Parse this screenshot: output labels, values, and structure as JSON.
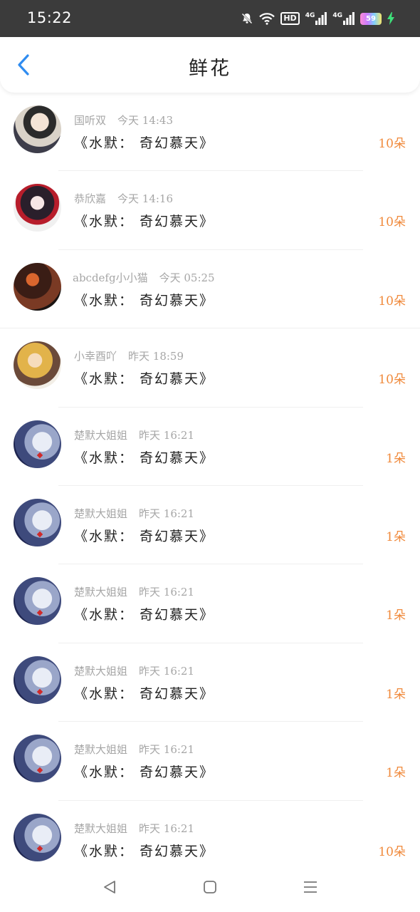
{
  "status_bar": {
    "time": "15:22",
    "hd_label": "HD",
    "signal1_label": "4G",
    "signal2_label": "4G",
    "battery_level": "59",
    "icons": [
      "mute-bell-icon",
      "wifi-icon",
      "hd-icon",
      "signal-4g-icon",
      "signal-4g-icon",
      "battery-icon",
      "charging-icon"
    ]
  },
  "header": {
    "title": "鲜花",
    "back_icon": "chevron-left-icon",
    "accent_color": "#2f8cf0"
  },
  "list": {
    "count_color": "#f08a3c",
    "items": [
      {
        "user": "国听双",
        "time": "今天 14:43",
        "title": "《水默：  奇幻慕天》",
        "count": "10朵"
      },
      {
        "user": "恭欣嘉",
        "time": "今天 14:16",
        "title": "《水默：  奇幻慕天》",
        "count": "10朵"
      },
      {
        "user": "abcdefg小小猫",
        "time": "今天 05:25",
        "title": "《水默：  奇幻慕天》",
        "count": "10朵"
      },
      {
        "user": "小幸酉吖",
        "time": "昨天 18:59",
        "title": "《水默：  奇幻慕天》",
        "count": "10朵"
      },
      {
        "user": "楚默大姐姐",
        "time": "昨天 16:21",
        "title": "《水默：  奇幻慕天》",
        "count": "1朵"
      },
      {
        "user": "楚默大姐姐",
        "time": "昨天 16:21",
        "title": "《水默：  奇幻慕天》",
        "count": "1朵"
      },
      {
        "user": "楚默大姐姐",
        "time": "昨天 16:21",
        "title": "《水默：  奇幻慕天》",
        "count": "1朵"
      },
      {
        "user": "楚默大姐姐",
        "time": "昨天 16:21",
        "title": "《水默：  奇幻慕天》",
        "count": "1朵"
      },
      {
        "user": "楚默大姐姐",
        "time": "昨天 16:21",
        "title": "《水默：  奇幻慕天》",
        "count": "1朵"
      },
      {
        "user": "楚默大姐姐",
        "time": "昨天 16:21",
        "title": "《水默：  奇幻慕天》",
        "count": "10朵"
      }
    ]
  },
  "bottom_nav": {
    "icons": [
      "back-triangle-icon",
      "home-square-icon",
      "menu-lines-icon"
    ]
  }
}
